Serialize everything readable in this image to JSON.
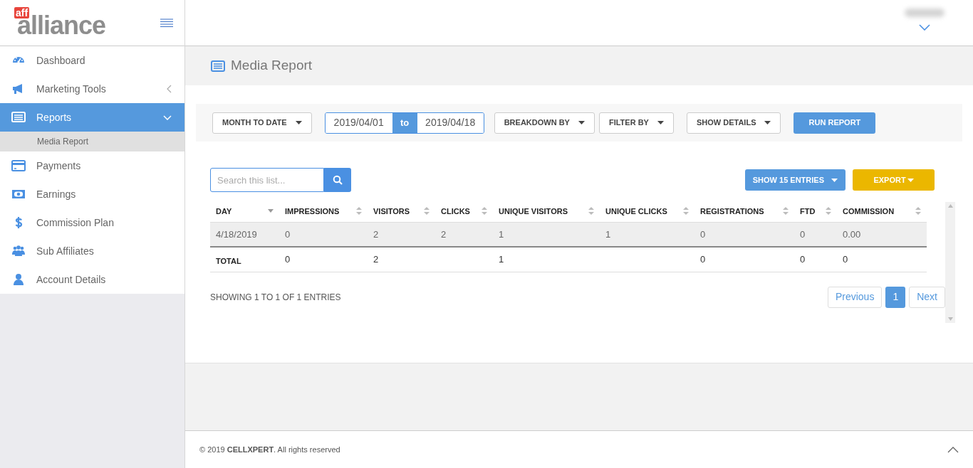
{
  "logo": {
    "small": "aff",
    "large": "alliance"
  },
  "sidebar": {
    "items": [
      {
        "label": "Dashboard",
        "selected": false
      },
      {
        "label": "Marketing Tools",
        "selected": false,
        "expanded": false
      },
      {
        "label": "Reports",
        "selected": true,
        "expanded": true,
        "children": [
          {
            "label": "Media Report",
            "selected": true
          }
        ]
      },
      {
        "label": "Payments",
        "selected": false
      },
      {
        "label": "Earnings",
        "selected": false
      },
      {
        "label": "Commission Plan",
        "selected": false
      },
      {
        "label": "Sub Affiliates",
        "selected": false
      },
      {
        "label": "Account Details",
        "selected": false
      }
    ]
  },
  "page_title": "Media Report",
  "filters": {
    "period": "MONTH TO DATE",
    "date_from": "2019/04/01",
    "date_sep": "to",
    "date_to": "2019/04/18",
    "breakdown": "BREAKDOWN BY",
    "filter": "FILTER BY",
    "details": "SHOW DETAILS",
    "run": "RUN REPORT"
  },
  "search": {
    "placeholder": "Search this list..."
  },
  "show_entries": "SHOW 15 ENTRIES",
  "export": "EXPORT",
  "table": {
    "columns": [
      {
        "label": "DAY",
        "sorted": true
      },
      {
        "label": "IMPRESSIONS",
        "sorted": false
      },
      {
        "label": "VISITORS",
        "sorted": false
      },
      {
        "label": "CLICKS",
        "sorted": false
      },
      {
        "label": "UNIQUE VISITORS",
        "sorted": false
      },
      {
        "label": "UNIQUE CLICKS",
        "sorted": false
      },
      {
        "label": "REGISTRATIONS",
        "sorted": false
      },
      {
        "label": "FTD",
        "sorted": false
      },
      {
        "label": "COMMISSION",
        "sorted": false
      }
    ],
    "rows": [
      [
        "4/18/2019",
        "0",
        "2",
        "2",
        "1",
        "1",
        "0",
        "0",
        "0.00"
      ]
    ],
    "total": {
      "label": "TOTAL",
      "impressions": "0",
      "visitors": "2",
      "unique_visitors": "1",
      "registrations": "0",
      "ftd": "0",
      "commission": "0"
    }
  },
  "info": "SHOWING 1 TO 1 OF 1 ENTRIES",
  "pagination": [
    {
      "label": "Previous",
      "selected": false
    },
    {
      "label": "1",
      "selected": true
    },
    {
      "label": "Next",
      "selected": false
    }
  ],
  "footer": {
    "text": "© 2019 **CELLXPERT**. All rights reserved"
  }
}
